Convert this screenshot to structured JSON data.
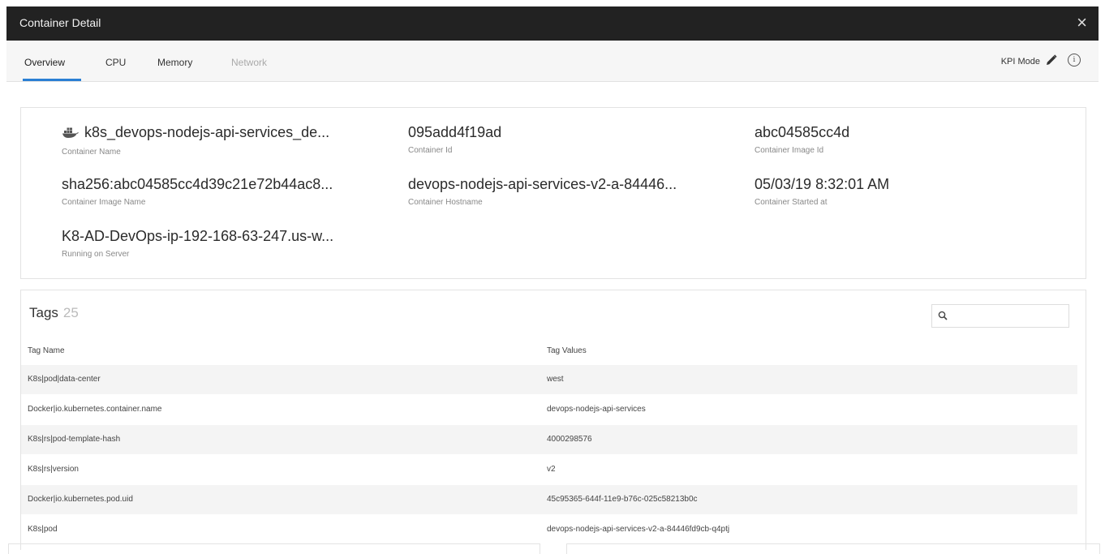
{
  "window": {
    "title": "Container Detail",
    "close_icon": "×"
  },
  "tabs": [
    {
      "label": "Overview",
      "state": "active"
    },
    {
      "label": "CPU",
      "state": "normal"
    },
    {
      "label": "Memory",
      "state": "normal"
    },
    {
      "label": "Network",
      "state": "disabled"
    }
  ],
  "toolbar": {
    "kpi_label": "KPI Mode",
    "info_glyph": "i"
  },
  "overview": {
    "container_name": {
      "value": "k8s_devops-nodejs-api-services_de...",
      "label": "Container Name"
    },
    "container_id": {
      "value": "095add4f19ad",
      "label": "Container Id"
    },
    "container_image_id": {
      "value": "abc04585cc4d",
      "label": "Container Image Id"
    },
    "container_image_name": {
      "value": "sha256:abc04585cc4d39c21e72b44ac8...",
      "label": "Container Image Name"
    },
    "container_hostname": {
      "value": "devops-nodejs-api-services-v2-a-84446...",
      "label": "Container Hostname"
    },
    "container_started": {
      "value": "05/03/19 8:32:01 AM",
      "label": "Container Started at"
    },
    "running_on": {
      "value": "K8-AD-DevOps-ip-192-168-63-247.us-w...",
      "label": "Running on Server"
    }
  },
  "tags": {
    "title": "Tags",
    "count": "25",
    "search_placeholder": "",
    "columns": {
      "name": "Tag Name",
      "value": "Tag Values"
    },
    "rows": [
      {
        "name": "K8s|pod|data-center",
        "value": "west"
      },
      {
        "name": "Docker|io.kubernetes.container.name",
        "value": "devops-nodejs-api-services"
      },
      {
        "name": "K8s|rs|pod-template-hash",
        "value": "4000298576"
      },
      {
        "name": "K8s|rs|version",
        "value": "v2"
      },
      {
        "name": "Docker|io.kubernetes.pod.uid",
        "value": "45c95365-644f-11e9-b76c-025c58213b0c"
      },
      {
        "name": "K8s|pod",
        "value": "devops-nodejs-api-services-v2-a-84446fd9cb-q4ptj"
      }
    ]
  },
  "colors": {
    "titlebar": "#222222",
    "accent": "#2a7fd4",
    "row_alt": "#f4f4f4"
  }
}
